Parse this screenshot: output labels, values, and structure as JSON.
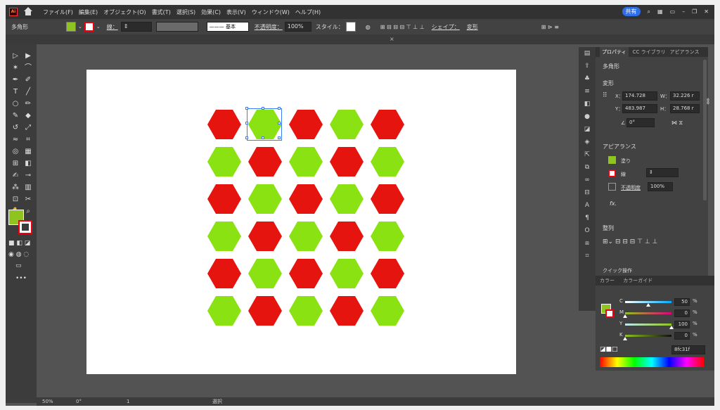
{
  "menubar": {
    "logo": "Ai",
    "items": [
      "ファイル(F)",
      "編集(E)",
      "オブジェクト(O)",
      "書式(T)",
      "選択(S)",
      "効果(C)",
      "表示(V)",
      "ウィンドウ(W)",
      "ヘルプ(H)"
    ],
    "share": "共有"
  },
  "control": {
    "object_type": "多角形",
    "stroke_label": "線：",
    "line_style": "基本",
    "opacity_label": "不透明度：",
    "opacity": "100%",
    "style_label": "スタイル：",
    "shape_label": "シェイプ：",
    "transform_label": "変形"
  },
  "tab": {
    "close": "×"
  },
  "canvas": {
    "rows": [
      [
        "red",
        "green",
        "red",
        "green",
        "red"
      ],
      [
        "green",
        "red",
        "green",
        "red",
        "green"
      ],
      [
        "red",
        "green",
        "red",
        "green",
        "red"
      ],
      [
        "green",
        "red",
        "green",
        "red",
        "green"
      ],
      [
        "red",
        "green",
        "red",
        "green",
        "red"
      ],
      [
        "green",
        "red",
        "green",
        "red",
        "green"
      ]
    ]
  },
  "colors": {
    "red": "#e5140e",
    "green": "#8be213",
    "fill": "#8fc31f"
  },
  "status": {
    "zoom": "50%",
    "rotation": "0°",
    "artboard": "1",
    "tool": "選択"
  },
  "properties": {
    "tabs": [
      "プロパティ",
      "CC ライブラリ",
      "アピアランス"
    ],
    "object": "多角形",
    "transform": "変形",
    "x_label": "X：",
    "x": "174.728",
    "y_label": "Y：",
    "y": "483.987",
    "w_label": "W：",
    "w": "32.226 r",
    "h_label": "H：",
    "h": "28.768 r",
    "angle": "0°",
    "appearance": "アピアランス",
    "fill_label": "塗り",
    "stroke_label": "線",
    "opacity_label": "不透明度",
    "opacity": "100%",
    "fx": "fx.",
    "align": "整列",
    "quick": "クイック操作"
  },
  "color_panel": {
    "tabs": [
      "カラー",
      "カラーガイド"
    ],
    "channels": [
      {
        "label": "C",
        "value": "50",
        "unit": "%"
      },
      {
        "label": "M",
        "value": "0",
        "unit": "%"
      },
      {
        "label": "Y",
        "value": "100",
        "unit": "%"
      },
      {
        "label": "K",
        "value": "0",
        "unit": "%"
      }
    ],
    "hex": "8fc31f"
  }
}
